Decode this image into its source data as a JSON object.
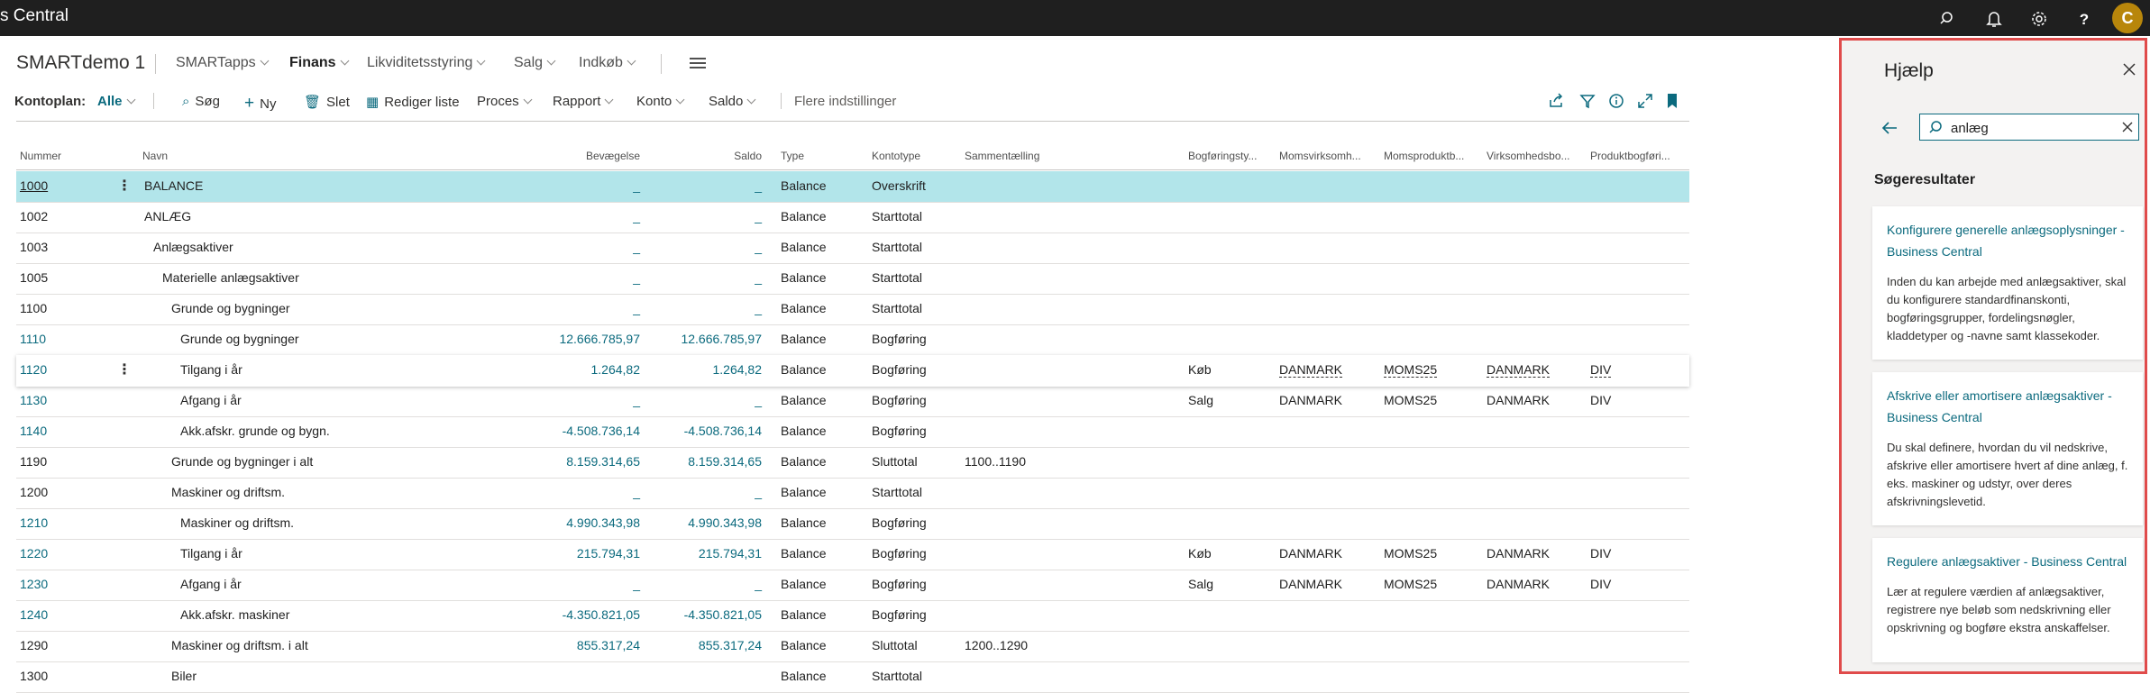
{
  "app": {
    "title": "s Central",
    "avatar_initial": "C"
  },
  "header": {
    "company": "SMARTdemo 1",
    "nav": [
      "SMARTapps",
      "Finans",
      "Likviditetsstyring",
      "Salg",
      "Indkøb"
    ]
  },
  "actions": {
    "kontoplan_label": "Kontoplan:",
    "filter_value": "Alle",
    "search": "Søg",
    "new": "Ny",
    "delete": "Slet",
    "edit_list": "Rediger liste",
    "process": "Proces",
    "report": "Rapport",
    "account": "Konto",
    "balance": "Saldo",
    "more_options": "Flere indstillinger"
  },
  "table": {
    "columns": {
      "nummer": "Nummer",
      "navn": "Navn",
      "bevaegelse": "Bevægelse",
      "saldo": "Saldo",
      "type": "Type",
      "kontotype": "Kontotype",
      "sammentaelling": "Sammentælling",
      "bogfoeringstype": "Bogføringsty...",
      "momsvirksomhed": "Momsvirksomh...",
      "momsprodukt": "Momsproduktb...",
      "virksomhedsbogf": "Virksomhedsbo...",
      "produktbogf": "Produktbogføri..."
    },
    "rows": [
      {
        "nummer": "1000",
        "navn": "BALANCE",
        "bevaegelse": "_",
        "saldo": "_",
        "type": "Balance",
        "kontotype": "Overskrift",
        "sammentaelling": "",
        "bogf": "",
        "momsv": "",
        "momsp": "",
        "virk": "",
        "prod": ""
      },
      {
        "nummer": "1002",
        "navn": "ANLÆG",
        "bevaegelse": "_",
        "saldo": "_",
        "type": "Balance",
        "kontotype": "Starttotal",
        "sammentaelling": "",
        "bogf": "",
        "momsv": "",
        "momsp": "",
        "virk": "",
        "prod": ""
      },
      {
        "nummer": "1003",
        "navn": "Anlægsaktiver",
        "bevaegelse": "_",
        "saldo": "_",
        "type": "Balance",
        "kontotype": "Starttotal",
        "sammentaelling": "",
        "bogf": "",
        "momsv": "",
        "momsp": "",
        "virk": "",
        "prod": ""
      },
      {
        "nummer": "1005",
        "navn": "Materielle anlægsaktiver",
        "bevaegelse": "_",
        "saldo": "_",
        "type": "Balance",
        "kontotype": "Starttotal",
        "sammentaelling": "",
        "bogf": "",
        "momsv": "",
        "momsp": "",
        "virk": "",
        "prod": ""
      },
      {
        "nummer": "1100",
        "navn": "Grunde og bygninger",
        "bevaegelse": "_",
        "saldo": "_",
        "type": "Balance",
        "kontotype": "Starttotal",
        "sammentaelling": "",
        "bogf": "",
        "momsv": "",
        "momsp": "",
        "virk": "",
        "prod": ""
      },
      {
        "nummer": "1110",
        "navn": "Grunde og bygninger",
        "bevaegelse": "12.666.785,97",
        "saldo": "12.666.785,97",
        "type": "Balance",
        "kontotype": "Bogføring",
        "sammentaelling": "",
        "bogf": "",
        "momsv": "",
        "momsp": "",
        "virk": "",
        "prod": ""
      },
      {
        "nummer": "1120",
        "navn": "Tilgang i år",
        "bevaegelse": "1.264,82",
        "saldo": "1.264,82",
        "type": "Balance",
        "kontotype": "Bogføring",
        "sammentaelling": "",
        "bogf": "Køb",
        "momsv": "DANMARK",
        "momsp": "MOMS25",
        "virk": "DANMARK",
        "prod": "DIV"
      },
      {
        "nummer": "1130",
        "navn": "Afgang i år",
        "bevaegelse": "_",
        "saldo": "_",
        "type": "Balance",
        "kontotype": "Bogføring",
        "sammentaelling": "",
        "bogf": "Salg",
        "momsv": "DANMARK",
        "momsp": "MOMS25",
        "virk": "DANMARK",
        "prod": "DIV"
      },
      {
        "nummer": "1140",
        "navn": "Akk.afskr. grunde og bygn.",
        "bevaegelse": "-4.508.736,14",
        "saldo": "-4.508.736,14",
        "type": "Balance",
        "kontotype": "Bogføring",
        "sammentaelling": "",
        "bogf": "",
        "momsv": "",
        "momsp": "",
        "virk": "",
        "prod": ""
      },
      {
        "nummer": "1190",
        "navn": "Grunde og bygninger i alt",
        "bevaegelse": "8.159.314,65",
        "saldo": "8.159.314,65",
        "type": "Balance",
        "kontotype": "Sluttotal",
        "sammentaelling": "1100..1190",
        "bogf": "",
        "momsv": "",
        "momsp": "",
        "virk": "",
        "prod": ""
      },
      {
        "nummer": "1200",
        "navn": "Maskiner og driftsm.",
        "bevaegelse": "_",
        "saldo": "_",
        "type": "Balance",
        "kontotype": "Starttotal",
        "sammentaelling": "",
        "bogf": "",
        "momsv": "",
        "momsp": "",
        "virk": "",
        "prod": ""
      },
      {
        "nummer": "1210",
        "navn": "Maskiner og driftsm.",
        "bevaegelse": "4.990.343,98",
        "saldo": "4.990.343,98",
        "type": "Balance",
        "kontotype": "Bogføring",
        "sammentaelling": "",
        "bogf": "",
        "momsv": "",
        "momsp": "",
        "virk": "",
        "prod": ""
      },
      {
        "nummer": "1220",
        "navn": "Tilgang i år",
        "bevaegelse": "215.794,31",
        "saldo": "215.794,31",
        "type": "Balance",
        "kontotype": "Bogføring",
        "sammentaelling": "",
        "bogf": "Køb",
        "momsv": "DANMARK",
        "momsp": "MOMS25",
        "virk": "DANMARK",
        "prod": "DIV"
      },
      {
        "nummer": "1230",
        "navn": "Afgang i år",
        "bevaegelse": "_",
        "saldo": "_",
        "type": "Balance",
        "kontotype": "Bogføring",
        "sammentaelling": "",
        "bogf": "Salg",
        "momsv": "DANMARK",
        "momsp": "MOMS25",
        "virk": "DANMARK",
        "prod": "DIV"
      },
      {
        "nummer": "1240",
        "navn": "Akk.afskr. maskiner",
        "bevaegelse": "-4.350.821,05",
        "saldo": "-4.350.821,05",
        "type": "Balance",
        "kontotype": "Bogføring",
        "sammentaelling": "",
        "bogf": "",
        "momsv": "",
        "momsp": "",
        "virk": "",
        "prod": ""
      },
      {
        "nummer": "1290",
        "navn": "Maskiner og driftsm. i alt",
        "bevaegelse": "855.317,24",
        "saldo": "855.317,24",
        "type": "Balance",
        "kontotype": "Sluttotal",
        "sammentaelling": "1200..1290",
        "bogf": "",
        "momsv": "",
        "momsp": "",
        "virk": "",
        "prod": ""
      },
      {
        "nummer": "1300",
        "navn": "Biler",
        "bevaegelse": "",
        "saldo": "",
        "type": "Balance",
        "kontotype": "Starttotal",
        "sammentaelling": "",
        "bogf": "",
        "momsv": "",
        "momsp": "",
        "virk": "",
        "prod": ""
      }
    ]
  },
  "help": {
    "title": "Hjælp",
    "search_value": "anlæg",
    "results_heading": "Søgeresultater",
    "results": [
      {
        "title": "Konfigurere generelle anlægsoplysninger - Business Central",
        "body": "Inden du kan arbejde med anlægsaktiver, skal du konfigurere standardfinanskonti, bogføringsgrupper, fordelingsnøgler, kladdetyper og -navne samt klassekoder."
      },
      {
        "title": "Afskrive eller amortisere anlægsaktiver - Business Central",
        "body": "Du skal definere, hvordan du vil nedskrive, afskrive eller amortisere hvert af dine anlæg, f. eks. maskiner og udstyr, over deres afskrivningslevetid."
      },
      {
        "title": "Regulere anlægsaktiver - Business Central",
        "body": "Lær at regulere værdien af anlægsaktiver, registrere nye beløb som nedskrivning eller opskrivning og bogføre ekstra anskaffelser."
      }
    ]
  },
  "colors": {
    "accent": "#0b6a7e",
    "selected_row": "#b2e5ea",
    "help_border": "#e04b4b",
    "topbar": "#1f1f1f"
  }
}
